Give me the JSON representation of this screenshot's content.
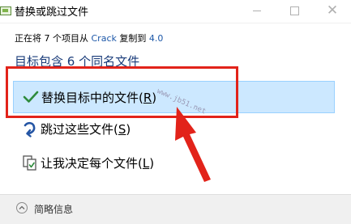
{
  "window": {
    "title": "替换或跳过文件",
    "icon": "folder-copy-icon"
  },
  "info": {
    "prefix": "正在将 7 个项目从",
    "source": "Crack",
    "middle": "复制到",
    "destination": "4.0"
  },
  "heading": "目标包含 6 个同名文件",
  "options": {
    "replace": {
      "text": "替换目标中的文件(",
      "key": "R",
      "suffix": ")",
      "icon": "check-icon"
    },
    "skip": {
      "text": "跳过这些文件(",
      "key": "S",
      "suffix": ")",
      "icon": "skip-arrow-icon"
    },
    "decide": {
      "text": "让我决定每个文件(",
      "key": "L",
      "suffix": ")",
      "icon": "decide-documents-icon"
    }
  },
  "footer": {
    "label": "简略信息",
    "icon": "chevron-up-icon"
  },
  "watermark": "www.jb51.net",
  "colors": {
    "selected_bg": "#cce8ff",
    "selected_border": "#99d1ff",
    "heading": "#1a3c7a",
    "link": "#1c57a8",
    "annotation": "#e2231a",
    "check": "#2e8b3c",
    "skip_arrow": "#2455a4"
  }
}
